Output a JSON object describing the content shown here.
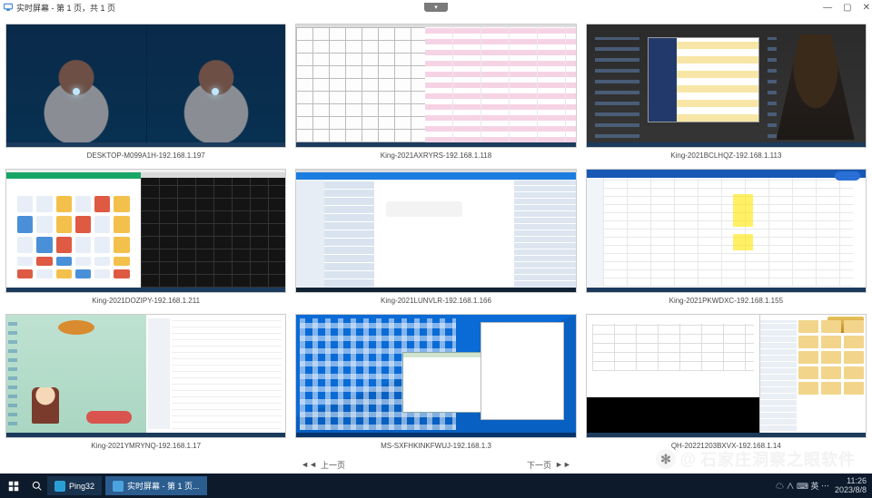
{
  "window": {
    "title": "实时屏幕 - 第 1 页，共 1 页"
  },
  "titlebar_controls": {
    "min": "—",
    "max": "▢",
    "close": "✕"
  },
  "center_tab_glyph": "▾",
  "screens": [
    {
      "caption": "DESKTOP-M099A1H-192.168.1.197"
    },
    {
      "caption": "King-2021AXRYRS-192.168.1.118"
    },
    {
      "caption": "King-2021BCLHQZ-192.168.1.113"
    },
    {
      "caption": "King-2021DOZIPY-192.168.1.211"
    },
    {
      "caption": "King-2021LUNVLR-192.168.1.166"
    },
    {
      "caption": "King-2021PKWDXC-192.168.1.155"
    },
    {
      "caption": "King-2021YMRYNQ-192.168.1.17"
    },
    {
      "caption": "MS-SXFHKINKFWUJ-192.168.1.3"
    },
    {
      "caption": "QH-20221203BXVX-192.168.1.14"
    }
  ],
  "pager": {
    "prev": "上一页",
    "next": "下一页",
    "prev_glyph": "◄◄",
    "next_glyph": "►►"
  },
  "taskbar": {
    "app1_label": "Ping32",
    "app2_label": "实时屏幕 - 第 1 页...",
    "tray_icons": "☁ ∧ ⌨ 英 ⋯",
    "clock_time": "11:26",
    "clock_date": "2023/8/8"
  },
  "watermark": {
    "at": "@",
    "text": "石家庄洞察之眼软件",
    "logo": "✻"
  }
}
